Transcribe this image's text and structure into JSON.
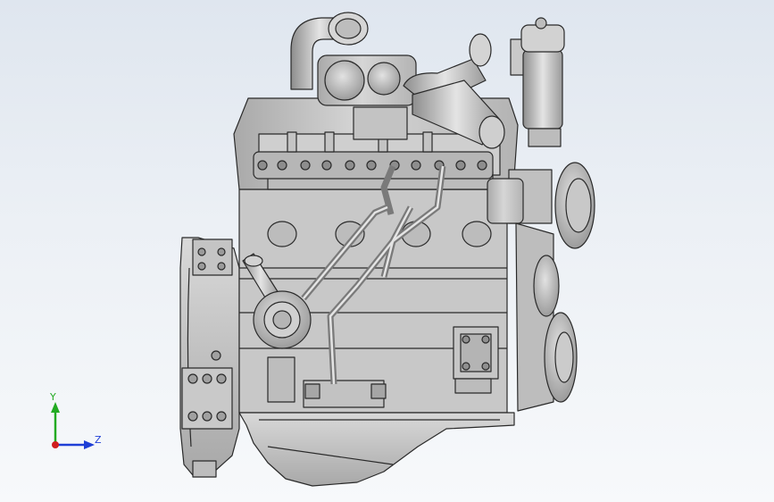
{
  "viewport": {
    "background_top": "#dfe6ef",
    "background_bottom": "#f7f9fb"
  },
  "model": {
    "icon": "engine-model",
    "body_color": "#c7c7c7",
    "edge_color": "#2a2a2a"
  },
  "triad": {
    "y_label": "Y",
    "z_label": "Z",
    "y_color": "#22aa22",
    "z_color": "#1f3fd6",
    "x_color": "#d01f1f"
  }
}
